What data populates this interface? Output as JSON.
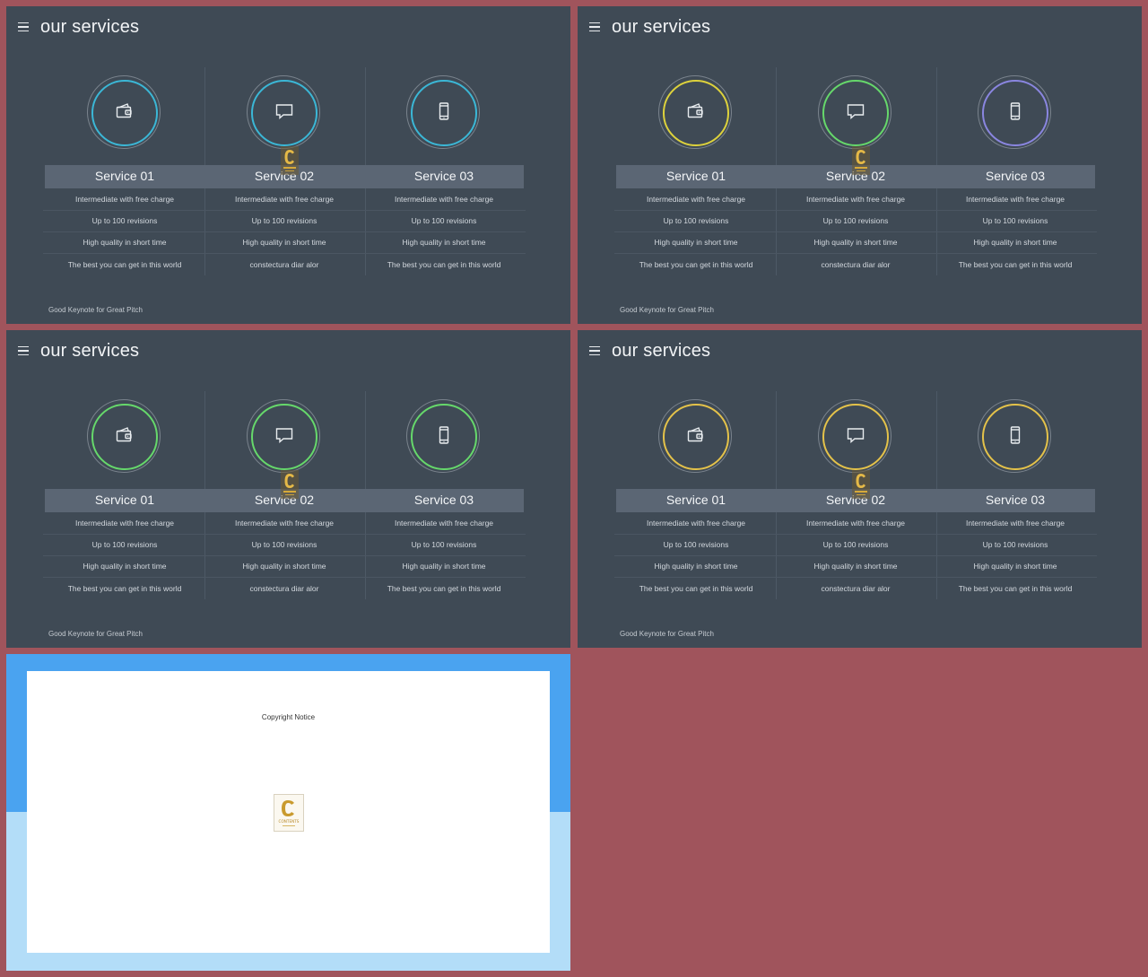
{
  "colors": {
    "background": "#a0545c",
    "slide_bg": "#3f4a55",
    "header_bar": "#5b6674",
    "accent_cyan": "#3bb7d6",
    "accent_yellow": "#ddd23c",
    "accent_green": "#66d86b",
    "accent_purple": "#8a86e0",
    "accent_gold": "#e4c24a",
    "copy_blue": "#4aa3f0",
    "copy_light_blue": "#b3ddf8"
  },
  "slides": [
    {
      "title": "our services",
      "footer": "Good Keynote for Great Pitch",
      "ring_colors": [
        "#3bb7d6",
        "#3bb7d6",
        "#3bb7d6"
      ],
      "services": [
        {
          "title": "Service 01",
          "icon": "wallet-icon",
          "rows": [
            "Intermediate with free charge",
            "Up to 100 revisions",
            "High quality in short time",
            "The best you can get in this world"
          ]
        },
        {
          "title": "Service 02",
          "icon": "chat-bubble-icon",
          "rows": [
            "Intermediate with free charge",
            "Up to 100 revisions",
            "High quality in short time",
            "constectura diar alor"
          ]
        },
        {
          "title": "Service 03",
          "icon": "smartphone-icon",
          "rows": [
            "Intermediate with free charge",
            "Up to 100 revisions",
            "High quality in short time",
            "The best you can get in this world"
          ]
        }
      ]
    },
    {
      "title": "our services",
      "footer": "Good Keynote for Great Pitch",
      "ring_colors": [
        "#ddd23c",
        "#66d86b",
        "#8a86e0"
      ],
      "services": [
        {
          "title": "Service 01",
          "icon": "wallet-icon",
          "rows": [
            "Intermediate with free charge",
            "Up to 100 revisions",
            "High quality in short time",
            "The best you can get in this world"
          ]
        },
        {
          "title": "Service 02",
          "icon": "chat-bubble-icon",
          "rows": [
            "Intermediate with free charge",
            "Up to 100 revisions",
            "High quality in short time",
            "constectura diar alor"
          ]
        },
        {
          "title": "Service 03",
          "icon": "smartphone-icon",
          "rows": [
            "Intermediate with free charge",
            "Up to 100 revisions",
            "High quality in short time",
            "The best you can get in this world"
          ]
        }
      ]
    },
    {
      "title": "our services",
      "footer": "Good Keynote for Great Pitch",
      "ring_colors": [
        "#66d86b",
        "#66d86b",
        "#66d86b"
      ],
      "services": [
        {
          "title": "Service 01",
          "icon": "wallet-icon",
          "rows": [
            "Intermediate with free charge",
            "Up to 100 revisions",
            "High quality in short time",
            "The best you can get in this world"
          ]
        },
        {
          "title": "Service 02",
          "icon": "chat-bubble-icon",
          "rows": [
            "Intermediate with free charge",
            "Up to 100 revisions",
            "High quality in short time",
            "constectura diar alor"
          ]
        },
        {
          "title": "Service 03",
          "icon": "smartphone-icon",
          "rows": [
            "Intermediate with free charge",
            "Up to 100 revisions",
            "High quality in short time",
            "The best you can get in this world"
          ]
        }
      ]
    },
    {
      "title": "our services",
      "footer": "Good Keynote for Great Pitch",
      "ring_colors": [
        "#e4c24a",
        "#e4c24a",
        "#e4c24a"
      ],
      "services": [
        {
          "title": "Service 01",
          "icon": "wallet-icon",
          "rows": [
            "Intermediate with free charge",
            "Up to 100 revisions",
            "High quality in short time",
            "The best you can get in this world"
          ]
        },
        {
          "title": "Service 02",
          "icon": "chat-bubble-icon",
          "rows": [
            "Intermediate with free charge",
            "Up to 100 revisions",
            "High quality in short time",
            "constectura diar alor"
          ]
        },
        {
          "title": "Service 03",
          "icon": "smartphone-icon",
          "rows": [
            "Intermediate with free charge",
            "Up to 100 revisions",
            "High quality in short time",
            "The best you can get in this world"
          ]
        }
      ]
    }
  ],
  "copyright": {
    "title": "Copyright Notice",
    "logo_text": "CONTENTS",
    "logo_letter": "C"
  }
}
